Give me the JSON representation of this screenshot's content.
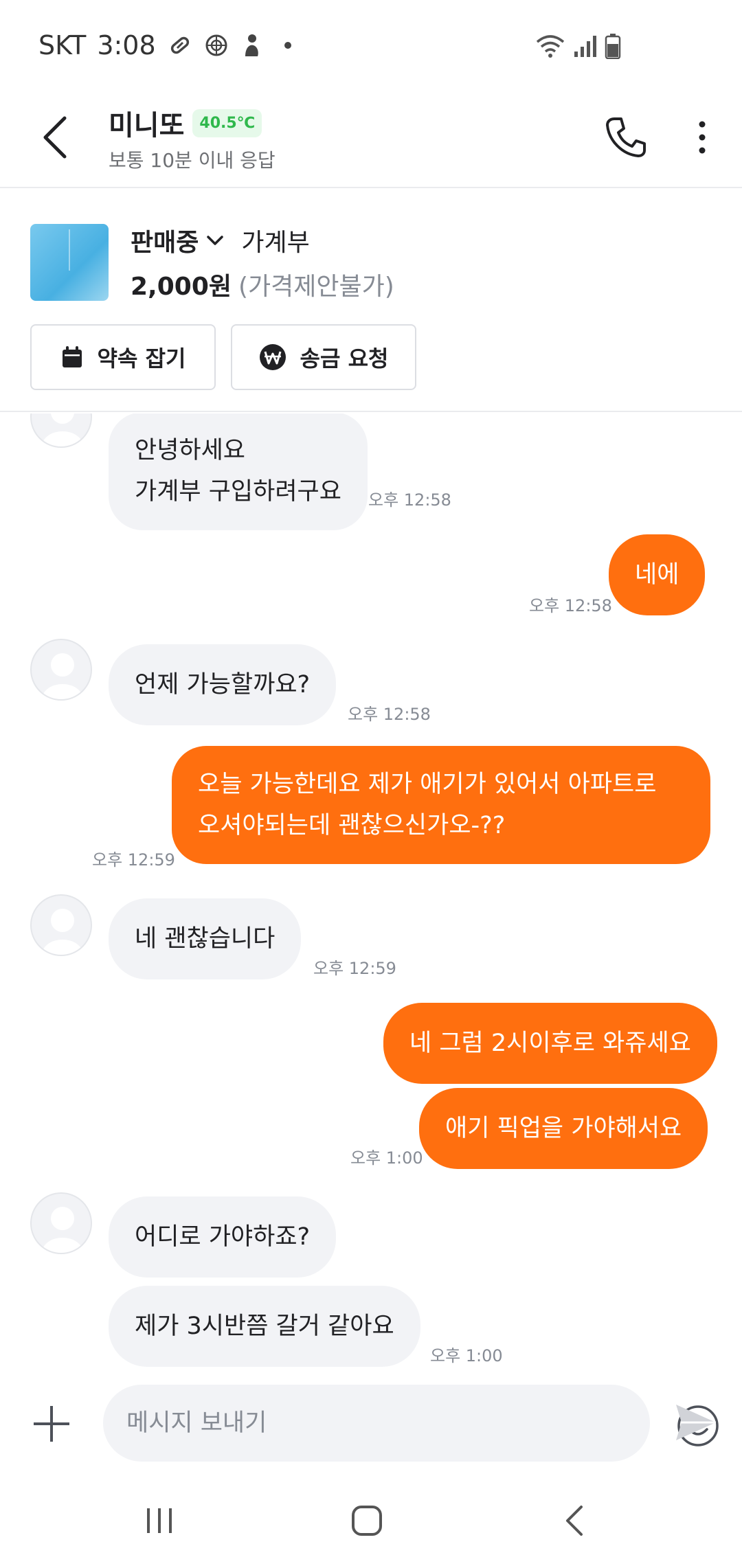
{
  "status_bar": {
    "carrier": "SKT",
    "time": "3:08",
    "icons": [
      "pill-icon",
      "settings-badge-icon",
      "person-icon",
      "dot-icon",
      "wifi-icon",
      "signal-icon",
      "battery-icon"
    ]
  },
  "header": {
    "name": "미니또",
    "temperature": "40.5℃",
    "response_time": "보통 10분 이내 응답",
    "temp_color": "#2fb84c"
  },
  "product": {
    "status": "판매중",
    "title": "가계부",
    "price": "2,000원",
    "negotiation": "(가격제안불가)",
    "buttons": {
      "appointment": "약속 잡기",
      "remit": "송금 요청"
    }
  },
  "messages": [
    {
      "from": "them",
      "lines": [
        "안녕하세요",
        "가계부 구입하려구요"
      ],
      "time": "오후 12:58"
    },
    {
      "from": "me",
      "lines": [
        "네에"
      ],
      "time": "오후 12:58"
    },
    {
      "from": "them",
      "lines": [
        "언제 가능할까요?"
      ],
      "time": "오후 12:58"
    },
    {
      "from": "me",
      "lines": [
        "오늘 가능한데요 제가 애기가 있어서 아파트로",
        "오셔야되는데 괜찮으신가오-??"
      ],
      "time": "오후 12:59"
    },
    {
      "from": "them",
      "lines": [
        "네 괜찮습니다"
      ],
      "time": "오후 12:59"
    },
    {
      "from": "me",
      "lines": [
        "네 그럼 2시이후로 와쥬세요"
      ]
    },
    {
      "from": "me",
      "lines": [
        "애기 픽업을 가야해서요"
      ],
      "time": "오후 1:00"
    },
    {
      "from": "them",
      "lines": [
        "어디로 가야하죠?"
      ]
    },
    {
      "from": "them",
      "lines": [
        "제가 3시반쯤 갈거 같아요"
      ],
      "time": "오후 1:00"
    }
  ],
  "composer": {
    "placeholder": "메시지 보내기"
  },
  "colors": {
    "accent": "#ff6f0f",
    "incoming_bubble": "#f2f3f6"
  }
}
